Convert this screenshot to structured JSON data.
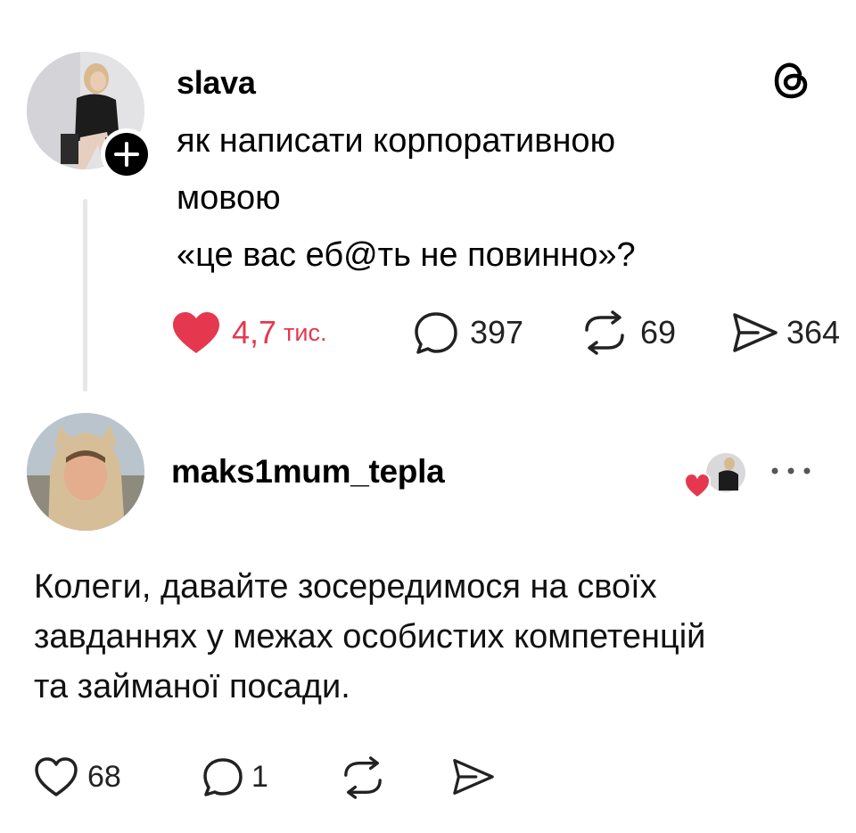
{
  "post": {
    "username": "slava",
    "text": "як написати корпоративною\nмовою\n«це вас еб@ть не повинно»?",
    "likes": {
      "value": "4,7",
      "unit": "тис."
    },
    "replies": "397",
    "reposts": "69",
    "shares": "364",
    "liked": true
  },
  "reply": {
    "username": "maks1mum_tepla",
    "text": "Колеги, давайте зосередимося на своїх\nзавданнях у межах особистих компетенцій\nта займаної посади.",
    "likes": "68",
    "replies": "1"
  },
  "icons": {
    "logo": "threads-logo-icon",
    "follow": "plus-icon",
    "like": "heart-icon",
    "reply": "speech-bubble-icon",
    "repost": "repost-icon",
    "share": "send-icon",
    "more": "more-horizontal-icon"
  },
  "colors": {
    "like": "#e5384f",
    "text": "#000000",
    "thread_line": "#e7e7e7"
  }
}
